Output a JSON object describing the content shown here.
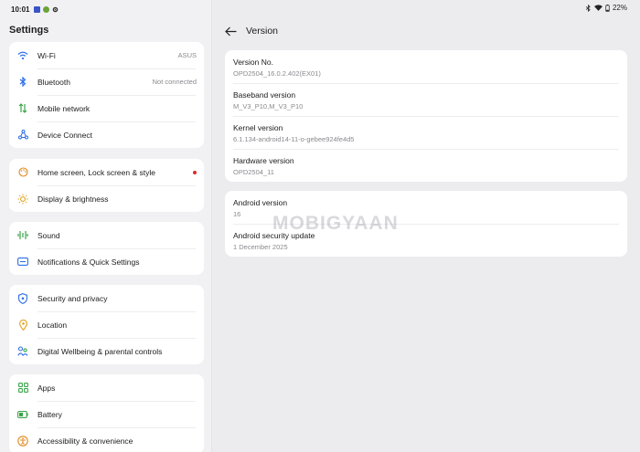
{
  "status": {
    "time": "10:01",
    "battery": "22%"
  },
  "left": {
    "title": "Settings",
    "groups": [
      [
        {
          "label": "Wi-Fi",
          "value": "ASUS"
        },
        {
          "label": "Bluetooth",
          "value": "Not connected"
        },
        {
          "label": "Mobile network"
        },
        {
          "label": "Device Connect"
        }
      ],
      [
        {
          "label": "Home screen, Lock screen & style"
        },
        {
          "label": "Display & brightness"
        }
      ],
      [
        {
          "label": "Sound"
        },
        {
          "label": "Notifications & Quick Settings"
        }
      ],
      [
        {
          "label": "Security and privacy"
        },
        {
          "label": "Location"
        },
        {
          "label": "Digital Wellbeing & parental controls"
        }
      ],
      [
        {
          "label": "Apps"
        },
        {
          "label": "Battery"
        },
        {
          "label": "Accessibility & convenience"
        }
      ]
    ]
  },
  "right": {
    "title": "Version",
    "card1": [
      {
        "title": "Version No.",
        "value": "OPD2504_16.0.2.402(EX01)"
      },
      {
        "title": "Baseband version",
        "value": "M_V3_P10,M_V3_P10"
      },
      {
        "title": "Kernel version",
        "value": "6.1.134-android14-11-o-gebee924fe4d5"
      },
      {
        "title": "Hardware version",
        "value": "OPD2504_11"
      }
    ],
    "card2": [
      {
        "title": "Android version",
        "value": "16"
      },
      {
        "title": "Android security update",
        "value": "1 December 2025"
      }
    ]
  },
  "watermark": "MOBIGYAAN",
  "colors": {
    "icon_blue": "#2c6ee8",
    "icon_green": "#3aa54a",
    "icon_orange": "#e08a1e",
    "icon_teal": "#1f9c9a",
    "badge_red": "#d92b2b"
  }
}
